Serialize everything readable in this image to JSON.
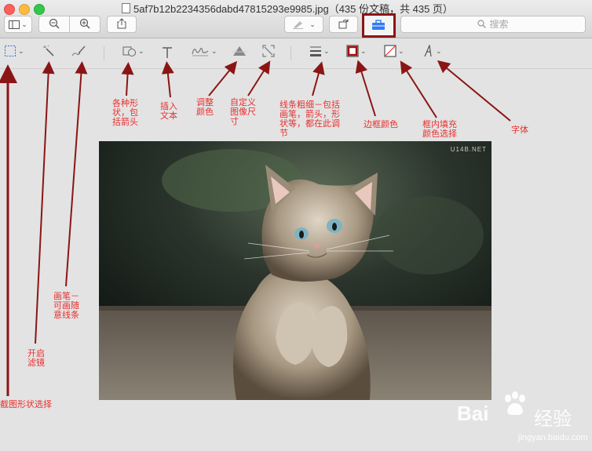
{
  "window": {
    "title": "5af7b12b2234356dabd47815293e9985.jpg（435 份文稿，共 435 页）"
  },
  "toolbar": {
    "search_placeholder": "搜索"
  },
  "annotations": {
    "crop_shape": "截图形状选择",
    "filter": "开启\n滤镜",
    "pen": "画笔－\n可画随\n意线条",
    "shapes": "各种形\n状，包\n括箭头",
    "text": "插入\n文本",
    "color": "调整\n颜色",
    "size": "自定义\n图像尺\n寸",
    "line": "线条粗细－包括\n画笔，箭头，形\n状等，都在此调\n节",
    "border": "边框颜色",
    "fill": "框内填充\n颜色选择",
    "font": "字体"
  },
  "image": {
    "watermark": "U14B.NET"
  },
  "watermark": {
    "brand": "Bai",
    "brand2": "经验",
    "url": "jingyan.baidu.com"
  },
  "colors": {
    "annotation": "#e8302f",
    "arrow": "#8b1515"
  }
}
